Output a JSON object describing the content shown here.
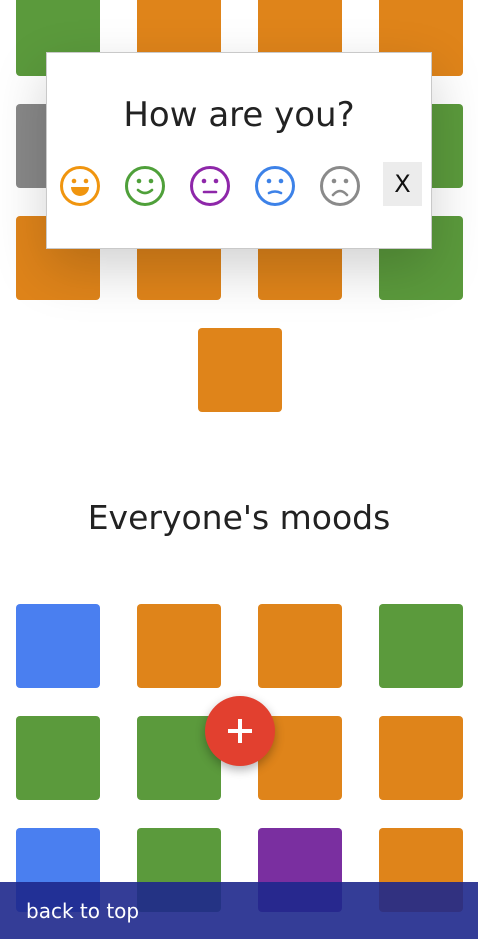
{
  "colors": {
    "green": "#5b9a3c",
    "orange": "#df841a",
    "gray": "#888888",
    "blue": "#4a7ff0",
    "purple": "#7a2fa0",
    "fab": "#e2402f",
    "bottom_bar": "#1e288c"
  },
  "dialog": {
    "title": "How are you?",
    "moods": [
      {
        "name": "very-happy",
        "icon": "laughing-face-icon",
        "color": "#f0950f"
      },
      {
        "name": "happy",
        "icon": "smiling-face-icon",
        "color": "#4fa03a"
      },
      {
        "name": "neutral",
        "icon": "neutral-face-icon",
        "color": "#8e27a9"
      },
      {
        "name": "sad",
        "icon": "sad-face-icon",
        "color": "#3d82e8"
      },
      {
        "name": "very-sad",
        "icon": "frowning-face-icon",
        "color": "#8a8a8a"
      }
    ],
    "close_label": "X"
  },
  "my_moods": {
    "tiles": [
      "green",
      "orange",
      "orange",
      "orange",
      "gray",
      "orange",
      "orange",
      "green",
      "orange",
      "orange",
      "orange",
      "green",
      "orange"
    ]
  },
  "everyone": {
    "title": "Everyone's moods",
    "tiles": [
      "blue",
      "orange",
      "orange",
      "green",
      "green",
      "green",
      "orange",
      "orange",
      "blue",
      "green",
      "purple",
      "orange"
    ]
  },
  "fab": {
    "icon": "plus-icon"
  },
  "footer": {
    "back_to_top": "back to top"
  }
}
